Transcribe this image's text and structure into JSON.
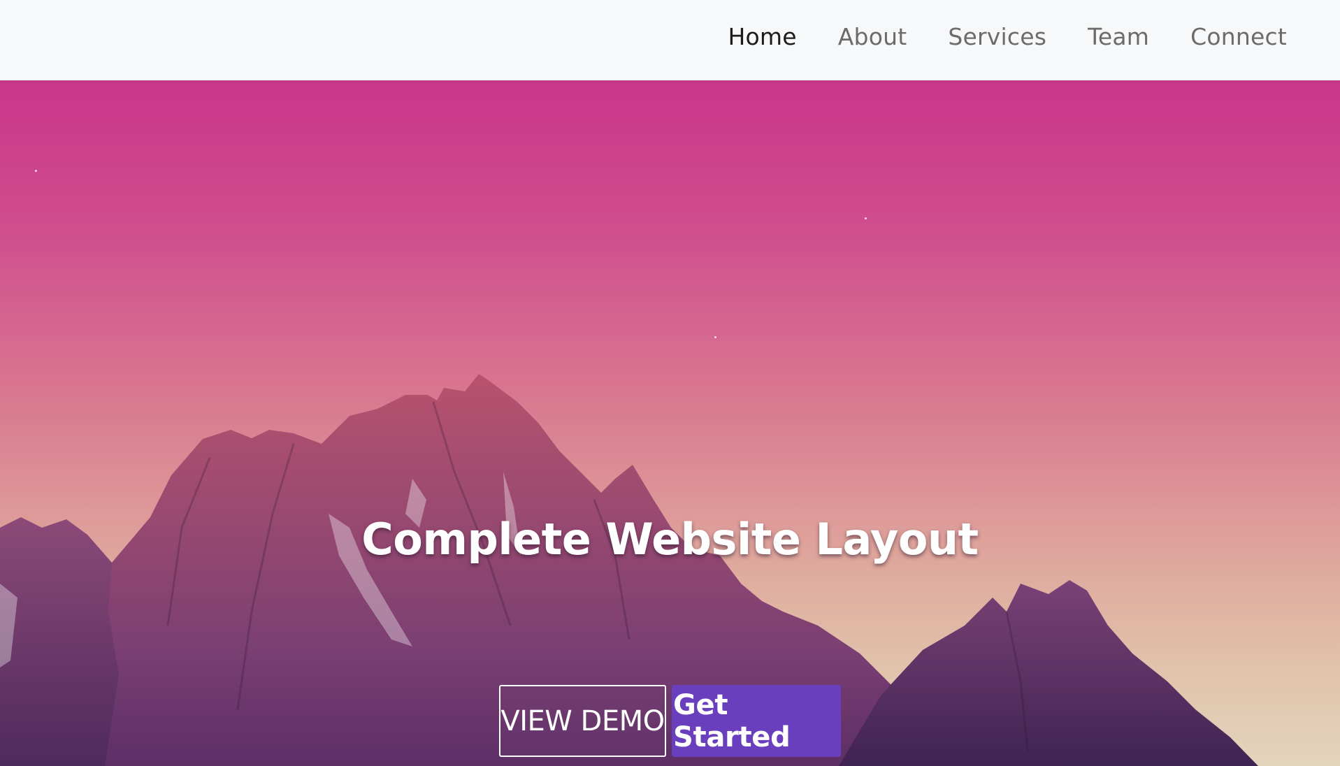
{
  "nav": {
    "items": [
      {
        "label": "Home",
        "active": true
      },
      {
        "label": "About",
        "active": false
      },
      {
        "label": "Services",
        "active": false
      },
      {
        "label": "Team",
        "active": false
      },
      {
        "label": "Connect",
        "active": false
      }
    ]
  },
  "hero": {
    "title": "Complete Website Layout",
    "buttons": {
      "demo_label": "VIEW DEMO",
      "start_label": "Get Started"
    }
  },
  "colors": {
    "navbar_bg": "#f7f8f9",
    "nav_active": "#1c1c1c",
    "nav_inactive": "#6b6b6b",
    "sky_top": "#c8368a",
    "sky_bottom": "#e4d4bc",
    "accent_button": "#6a3fbe"
  }
}
